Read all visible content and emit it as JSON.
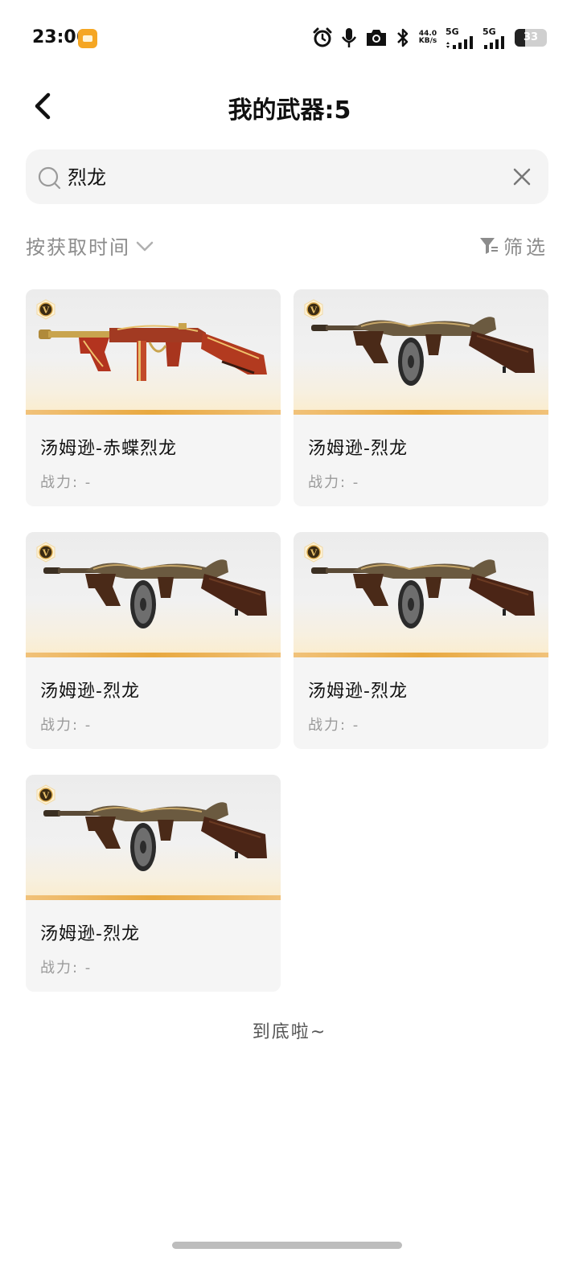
{
  "status_bar": {
    "time": "23:06",
    "net_speed_value": "44.0",
    "net_speed_unit": "KB/s",
    "sim1_label": "5G",
    "sim2_label": "5G",
    "battery": "33",
    "battery_level_percent": 33
  },
  "header": {
    "title": "我的武器:5"
  },
  "search": {
    "value": "烈龙"
  },
  "sort": {
    "label": "按获取时间"
  },
  "filter": {
    "label": "筛选"
  },
  "weapons": [
    {
      "name": "汤姆逊-赤蝶烈龙",
      "power": "战力: -",
      "variant": "red"
    },
    {
      "name": "汤姆逊-烈龙",
      "power": "战力: -",
      "variant": "bronze"
    },
    {
      "name": "汤姆逊-烈龙",
      "power": "战力: -",
      "variant": "bronze"
    },
    {
      "name": "汤姆逊-烈龙",
      "power": "战力: -",
      "variant": "bronze"
    },
    {
      "name": "汤姆逊-烈龙",
      "power": "战力: -",
      "variant": "bronze"
    }
  ],
  "rarity_badge_letter": "V",
  "footer": {
    "end_text": "到底啦~"
  },
  "colors": {
    "accent_gold": "#e8a83f",
    "muted_text": "#8c8c8c",
    "card_bg": "#f5f5f5"
  }
}
